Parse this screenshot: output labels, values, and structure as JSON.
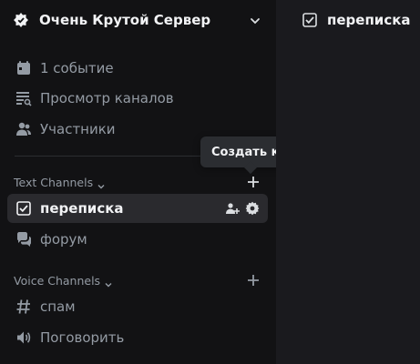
{
  "server": {
    "name": "Очень Крутой Сервер",
    "icon": "server-badge-icon"
  },
  "nav": [
    {
      "label": "1 событие",
      "icon": "calendar-icon"
    },
    {
      "label": "Просмотр каналов",
      "icon": "browse-channels-icon"
    },
    {
      "label": "Участники",
      "icon": "members-icon"
    }
  ],
  "categories": {
    "text": {
      "label": "Text Channels"
    },
    "voice": {
      "label": "Voice Channels"
    }
  },
  "text_channels": [
    {
      "label": "переписка",
      "icon": "text-channel-icon",
      "active": true
    },
    {
      "label": "форум",
      "icon": "forum-icon",
      "active": false
    }
  ],
  "voice_channels": [
    {
      "label": "спам",
      "icon": "hashtag-icon"
    },
    {
      "label": "Поговорить",
      "icon": "speaker-icon"
    }
  ],
  "tooltip": {
    "text": "Создать канал"
  },
  "main": {
    "channel_title": "переписка"
  },
  "colors": {
    "sidebar_bg": "#121214",
    "main_bg": "#1a1a1e",
    "active_bg": "#2a2a2e",
    "muted_text": "#949ba4",
    "bright_text": "#f2f3f5"
  }
}
